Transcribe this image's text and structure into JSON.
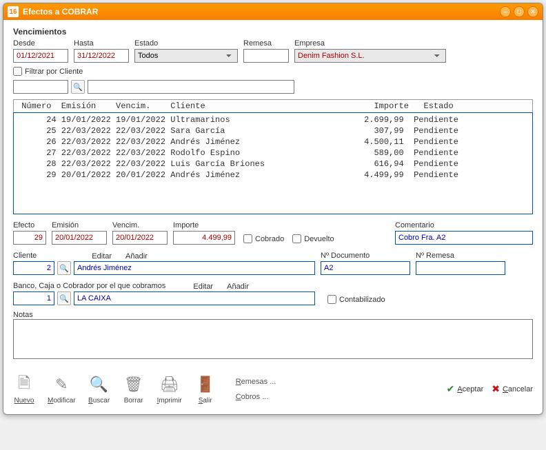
{
  "window": {
    "title": "Efectos a COBRAR"
  },
  "vencimientos": {
    "title": "Vencimientos",
    "desde_label": "Desde",
    "desde": "01/12/2021",
    "hasta_label": "Hasta",
    "hasta": "31/12/2022",
    "estado_label": "Estado",
    "estado": "Todos",
    "remesa_label": "Remesa",
    "remesa": "",
    "empresa_label": "Empresa",
    "empresa": "Denim Fashion S.L."
  },
  "filter": {
    "label": "Filtrar por Cliente",
    "code": "",
    "name": ""
  },
  "grid": {
    "header": " Número  Emisión    Vencim.    Cliente                                  Importe   Estado",
    "rows": [
      "      24 19/01/2022 19/01/2022 Ultramarinos                           2.699,99  Pendiente",
      "      25 22/03/2022 22/03/2022 Sara García                              307,99  Pendiente",
      "      26 22/03/2022 22/03/2022 Andrés Jiménez                         4.500,11  Pendiente",
      "      27 22/03/2022 22/03/2022 Rodolfo Espino                           589,00  Pendiente",
      "      28 22/03/2022 22/03/2022 Luis García Briones                      616,94  Pendiente",
      "      29 20/01/2022 20/01/2022 Andrés Jiménez                         4.499,99  Pendiente"
    ]
  },
  "detail": {
    "efecto_label": "Efecto",
    "efecto": "29",
    "emision_label": "Emisión",
    "emision": "20/01/2022",
    "vencim_label": "Vencim.",
    "vencim": "20/01/2022",
    "importe_label": "Importe",
    "importe": "4.499,99",
    "cobrado_label": "Cobrado",
    "devuelto_label": "Devuelto",
    "comentario_label": "Comentario",
    "comentario": "Cobro Fra. A2",
    "cliente_label": "Cliente",
    "editar": "Editar",
    "anadir": "Añadir",
    "cliente_code": "2",
    "cliente_name": "Andrés Jiménez",
    "ndoc_label": "Nº Documento",
    "ndoc": "A2",
    "nremesa_label": "Nº Remesa",
    "nremesa": "",
    "banco_label": "Banco, Caja o Cobrador por el que cobramos",
    "banco_code": "1",
    "banco_name": "LA CAIXA",
    "contabilizado_label": "Contabilizado",
    "notas_label": "Notas",
    "notas": ""
  },
  "toolbar": {
    "nuevo": "Nuevo",
    "modificar": "Modificar",
    "buscar": "Buscar",
    "borrar": "Borrar",
    "imprimir": "Imprimir",
    "salir": "Salir",
    "remesas": "Remesas ...",
    "cobros": "Cobros ...",
    "aceptar": "Aceptar",
    "cancelar": "Cancelar"
  }
}
